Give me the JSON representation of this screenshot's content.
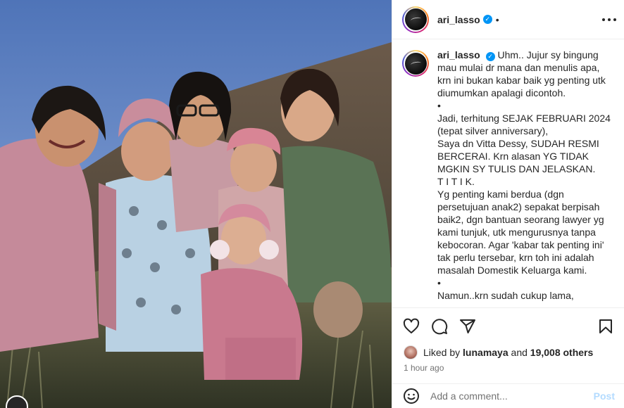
{
  "post": {
    "username": "ari_lasso",
    "verified_mark": "✓",
    "separator": "•"
  },
  "caption": {
    "username": "ari_lasso",
    "lines": [
      "Uhm.. Jujur sy bingung mau mulai dr mana dan menulis apa, krn ini bukan kabar baik yg penting utk diumumkan apalagi dicontoh.",
      "•",
      "Jadi, terhitung SEJAK FEBRUARI 2024 (tepat silver anniversary),",
      "Saya dn Vitta Dessy, SUDAH RESMI BERCERAI. Krn alasan YG TIDAK MGKIN SY TULIS DAN JELASKAN.",
      "T I T I K.",
      "Yg penting kami berdua (dgn persetujuan anak2) sepakat berpisah baik2, dgn bantuan seorang lawyer yg kami tunjuk, utk mengurusnya tanpa kebocoran. Agar 'kabar tak penting ini' tak perlu tersebar, krn toh ini adalah masalah Domestik Keluarga kami.",
      "•",
      "Namun..krn sudah cukup lama,"
    ]
  },
  "likes": {
    "prefix": "Liked by",
    "user": "lunamaya",
    "middle": "and",
    "count": "19,008 others"
  },
  "timestamp": "1 hour ago",
  "comment": {
    "placeholder": "Add a comment...",
    "post_label": "Post"
  },
  "colors": {
    "verified": "#0095f6",
    "post_disabled": "#b3dbff",
    "secondary_text": "#737373",
    "border": "#efefef"
  },
  "icons": {
    "like": "heart-icon",
    "comment": "comment-icon",
    "share": "share-icon",
    "save": "bookmark-icon",
    "emoji": "emoji-icon",
    "more": "more-options-icon"
  }
}
